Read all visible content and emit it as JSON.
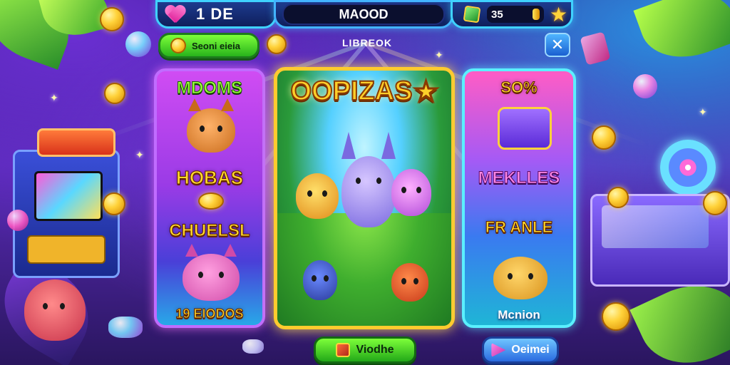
{
  "hud": {
    "lives_label": "1 DE",
    "center_title": "MAOOD",
    "currency_value": "35"
  },
  "subbar": {
    "coin_button_label": "Seoni eieia",
    "title": "LIBREOK"
  },
  "cards": {
    "left": {
      "title": "MDOMS",
      "label_mid": "HOBAS",
      "label_lower": "CHUELSL",
      "label_bottom": "19 EIODOS"
    },
    "center": {
      "title": "OOPIZAS"
    },
    "right": {
      "title": "SO%",
      "label_mid": "MEKLLES",
      "label_lower": "FR ANLE",
      "label_bottom": "Mcnion"
    }
  },
  "buttons": {
    "primary": "Viodhe",
    "secondary": "Oeimei"
  },
  "colors": {
    "left_card_border": "#c06cff",
    "center_card_border": "#ffcb2e",
    "right_card_border": "#5af0ff",
    "primary_button": "#22a818",
    "secondary_button": "#2a6ae0"
  }
}
